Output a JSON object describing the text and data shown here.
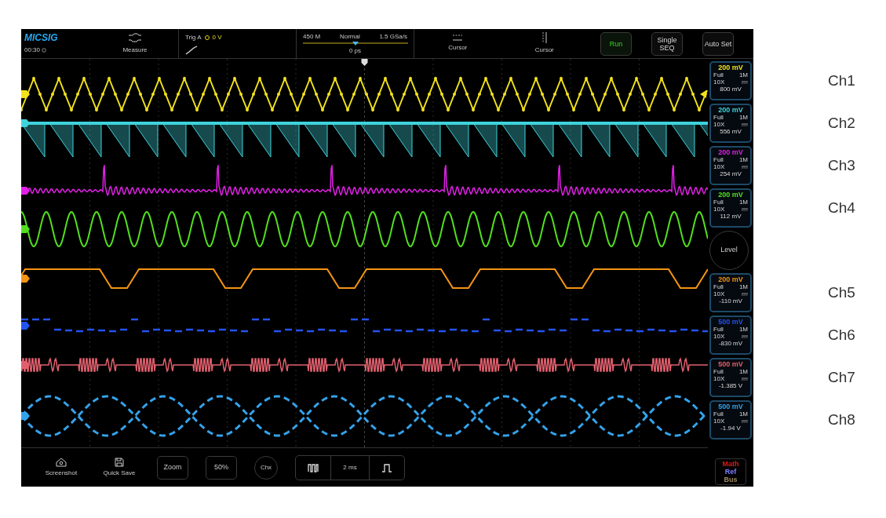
{
  "top_bar": {
    "logo": "MICSIG",
    "time": "00:30",
    "measure": "Measure",
    "trigger": {
      "label": "Trig A",
      "level": "0 V"
    },
    "timebase": {
      "depth": "450 M",
      "mode": "Normal",
      "rate": "1.5 GSa/s",
      "delay": "0 ps"
    },
    "cursors": [
      "Cursor",
      "Cursor"
    ],
    "buttons": [
      {
        "label": "Run",
        "active": true
      },
      {
        "label": "Single SEQ",
        "active": false
      },
      {
        "label": "Auto Set",
        "active": false
      }
    ]
  },
  "channels": [
    {
      "name": "Ch1",
      "color": "#f2e21c",
      "scale": "200 mV",
      "coupling": "Full",
      "impedance": "1M",
      "probe": "10X",
      "offset": "800 mV",
      "kind": "triangle"
    },
    {
      "name": "Ch2",
      "color": "#3fd3dc",
      "scale": "200 mV",
      "coupling": "Full",
      "impedance": "1M",
      "probe": "10X",
      "offset": "556 mV",
      "kind": "sawtooth"
    },
    {
      "name": "Ch3",
      "color": "#e020e6",
      "scale": "200 mV",
      "coupling": "Full",
      "impedance": "1M",
      "probe": "10X",
      "offset": "254 mV",
      "kind": "ringing"
    },
    {
      "name": "Ch4",
      "color": "#52e01e",
      "scale": "200 mV",
      "coupling": "Full",
      "impedance": "1M",
      "probe": "10X",
      "offset": "112 mV",
      "kind": "sine"
    },
    {
      "name": "Ch5",
      "color": "#f39414",
      "scale": "200 mV",
      "coupling": "Full",
      "impedance": "1M",
      "probe": "10X",
      "offset": "-110 mV",
      "kind": "trapezoid"
    },
    {
      "name": "Ch6",
      "color": "#2453f0",
      "scale": "500 mV",
      "coupling": "Full",
      "impedance": "1M",
      "probe": "10X",
      "offset": "-830 mV",
      "kind": "digital"
    },
    {
      "name": "Ch7",
      "color": "#e2606e",
      "scale": "500 mV",
      "coupling": "Full",
      "impedance": "1M",
      "probe": "10X",
      "offset": "-1.385 V",
      "kind": "burst"
    },
    {
      "name": "Ch8",
      "color": "#34a2ea",
      "scale": "500 mV",
      "coupling": "Full",
      "impedance": "1M",
      "probe": "10X",
      "offset": "-1.94 V",
      "kind": "dashed_sine"
    }
  ],
  "level_button": "Level",
  "bottom_bar": {
    "screenshot": "Screenshot",
    "quick_save": "Quick Save",
    "zoom": "Zoom",
    "fifty": "50%",
    "channel": "Chx",
    "timebase": "2 ms",
    "modes": [
      {
        "label": "Math",
        "color": "#e01818"
      },
      {
        "label": "Ref",
        "color": "#8080ff"
      },
      {
        "label": "Bus",
        "color": "#a08a60"
      }
    ]
  }
}
